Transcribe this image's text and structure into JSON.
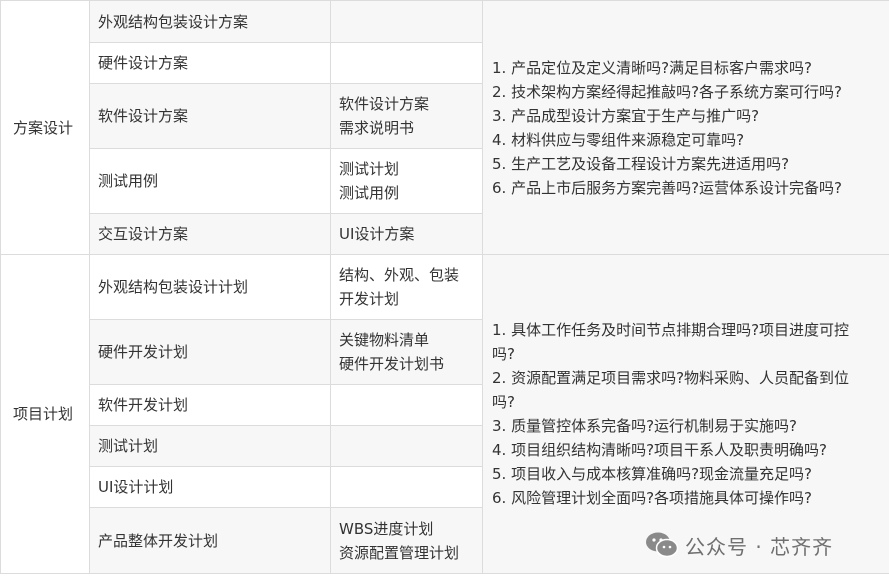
{
  "sections": [
    {
      "category": "方案设计",
      "rows": [
        {
          "item": "外观结构包装设计方案",
          "output": []
        },
        {
          "item": "硬件设计方案",
          "output": []
        },
        {
          "item": "软件设计方案",
          "output": [
            "软件设计方案",
            "需求说明书"
          ]
        },
        {
          "item": "测试用例",
          "output": [
            "测试计划",
            "测试用例"
          ]
        },
        {
          "item": "交互设计方案",
          "output": [
            "UI设计方案"
          ]
        }
      ],
      "questions": [
        "1. 产品定位及定义清晰吗?满足目标客户需求吗?",
        "2. 技术架构方案经得起推敲吗?各子系统方案可行吗?",
        "3. 产品成型设计方案宜于生产与推广吗?",
        "4. 材料供应与零组件来源稳定可靠吗?",
        "5. 生产工艺及设备工程设计方案先进适用吗?",
        "6. 产品上市后服务方案完善吗?运营体系设计完备吗?"
      ]
    },
    {
      "category": "项目计划",
      "rows": [
        {
          "item": "外观结构包装设计计划",
          "output": [
            "结构、外观、包装",
            "开发计划"
          ]
        },
        {
          "item": "硬件开发计划",
          "output": [
            "关键物料清单",
            "硬件开发计划书"
          ]
        },
        {
          "item": "软件开发计划",
          "output": []
        },
        {
          "item": "测试计划",
          "output": []
        },
        {
          "item": "UI设计计划",
          "output": []
        },
        {
          "item": "产品整体开发计划",
          "output": [
            "WBS进度计划",
            "资源配置管理计划"
          ]
        }
      ],
      "questions": [
        "1. 具体工作任务及时间节点排期合理吗?项目进度可控",
        "吗?",
        "2. 资源配置满足项目需求吗?物料采购、人员配备到位",
        "吗?",
        "3. 质量管控体系完备吗?运行机制易于实施吗?",
        "4. 项目组织结构清晰吗?项目干系人及职责明确吗?",
        "5. 项目收入与成本核算准确吗?现金流量充足吗?",
        "6. 风险管理计划全面吗?各项措施具体可操作吗?"
      ]
    }
  ],
  "watermark": {
    "text": "公众号 · 芯齐齐",
    "icon": "wechat-icon"
  }
}
